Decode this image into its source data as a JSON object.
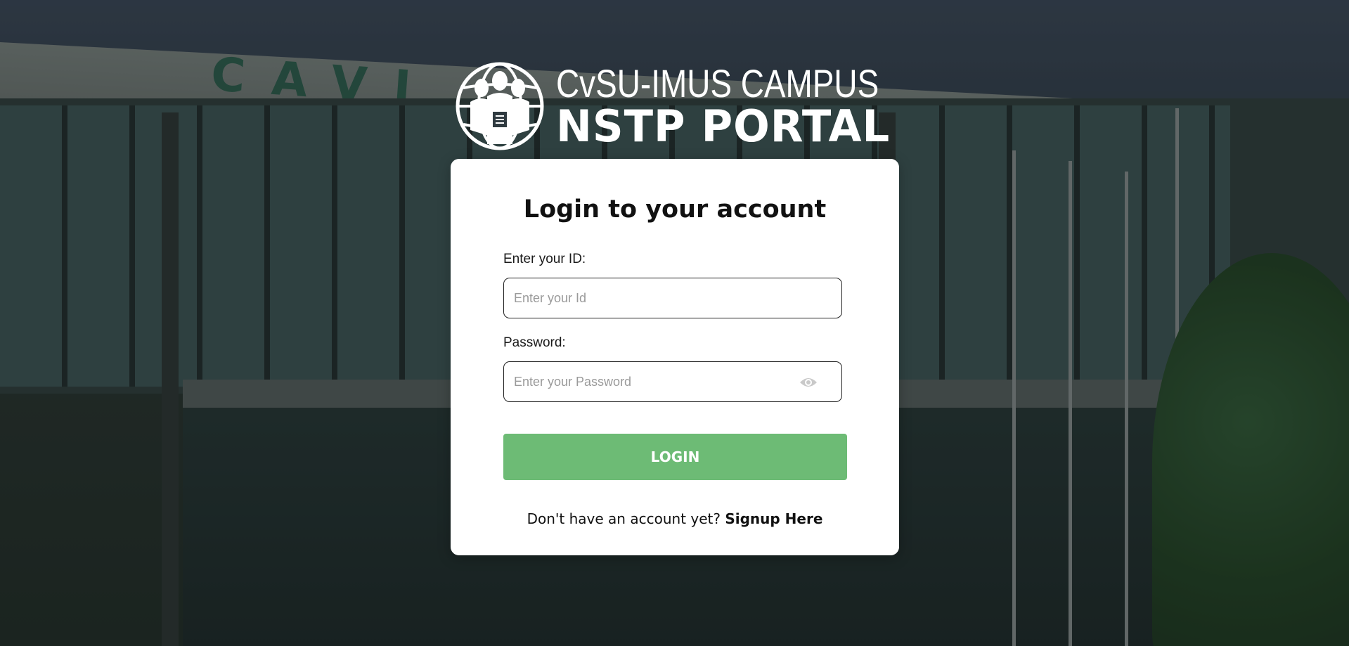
{
  "brand": {
    "line1": "CvSU-IMUS CAMPUS",
    "line2": "NSTP PORTAL",
    "logo_icon": "globe-people-icon"
  },
  "background": {
    "sign_text": "CAVITE STATE UNIVERSITY - IMUS"
  },
  "login": {
    "title": "Login to your account",
    "id_label": "Enter your ID:",
    "id_placeholder": "Enter your Id",
    "id_value": "",
    "password_label": "Password:",
    "password_placeholder": "Enter your Password",
    "password_value": "",
    "toggle_icon": "eye-icon",
    "button_label": "LOGIN",
    "signup_prompt": "Don't have an account yet?",
    "signup_link": "Signup Here"
  },
  "colors": {
    "button_green": "#6dbb75",
    "card_bg": "#ffffff",
    "text": "#111111"
  }
}
